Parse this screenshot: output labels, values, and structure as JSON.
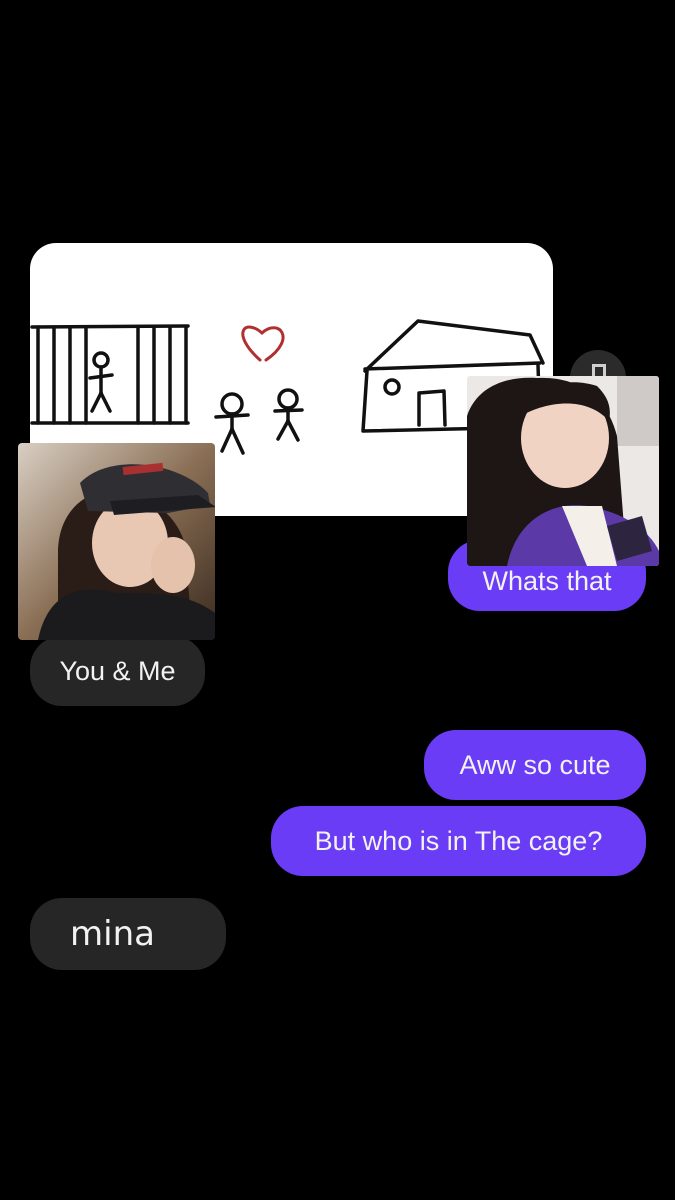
{
  "thread": {
    "shared_image": {
      "icon": "stick-figure-drawing",
      "label": "Drawing of a caged figure, a couple with a heart, and a house"
    },
    "reaction_button": {
      "icon": "react-icon"
    },
    "messages": [
      {
        "id": "m1",
        "sender": "me",
        "text": "Whats that"
      },
      {
        "id": "m2",
        "sender": "them",
        "text": "You & Me"
      },
      {
        "id": "m3",
        "sender": "me",
        "text": "Aww so cute"
      },
      {
        "id": "m4",
        "sender": "me",
        "text": "But who is in The cage?"
      },
      {
        "id": "m5",
        "sender": "them",
        "text": "mina"
      }
    ]
  },
  "overlays": {
    "left_photo": {
      "icon": "portrait-photo"
    },
    "right_photo": {
      "icon": "portrait-photo"
    }
  },
  "colors": {
    "background": "#000000",
    "outgoing_bubble": "#6b3cf5",
    "incoming_bubble": "#262626",
    "heart": "#c0392b"
  }
}
